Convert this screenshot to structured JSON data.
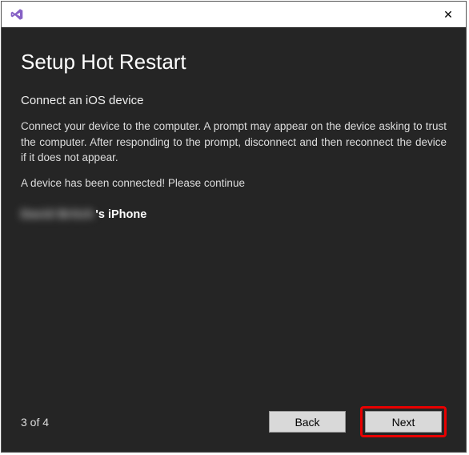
{
  "titlebar": {
    "app_icon": "visual-studio-icon",
    "close_glyph": "✕"
  },
  "page": {
    "title": "Setup Hot Restart",
    "subtitle": "Connect an iOS device",
    "instructions": "Connect your device to the computer. A prompt may appear on the device asking to trust the computer. After responding to the prompt, disconnect and then reconnect the device if it does not appear.",
    "status": "A device has been connected! Please continue",
    "device_name_blurred": "David Britch",
    "device_name_suffix": "'s iPhone"
  },
  "footer": {
    "progress": "3 of 4",
    "back_label": "Back",
    "next_label": "Next"
  }
}
